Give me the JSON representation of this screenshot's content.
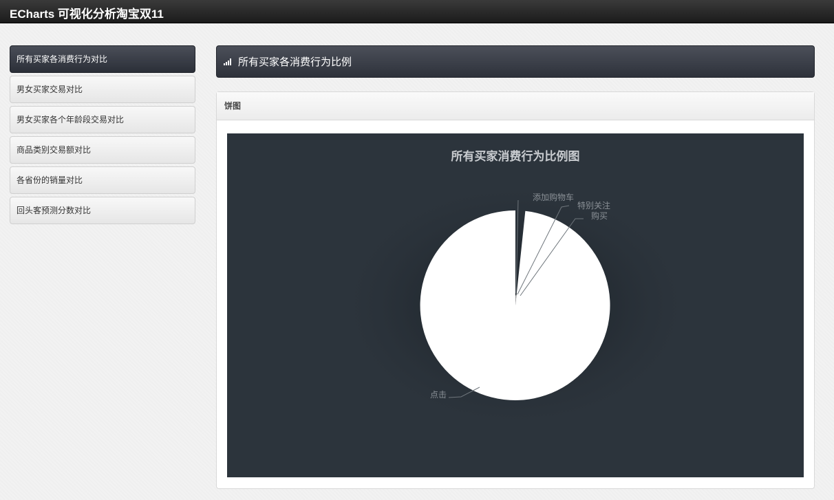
{
  "app": {
    "title": "ECharts 可视化分析淘宝双11"
  },
  "sidebar": {
    "items": [
      {
        "label": "所有买家各消费行为对比",
        "active": true
      },
      {
        "label": "男女买家交易对比"
      },
      {
        "label": "男女买家各个年龄段交易对比"
      },
      {
        "label": "商品类别交易额对比"
      },
      {
        "label": "各省份的销量对比"
      },
      {
        "label": "回头客预测分数对比"
      }
    ]
  },
  "main": {
    "header_icon": "signal-bars-icon",
    "title": "所有买家各消费行为比例",
    "panel_title": "饼图"
  },
  "colors": {
    "chart_bg": "#2c343c",
    "slice_main": "#ffffff",
    "label_text": "#8a9096"
  },
  "chart_data": {
    "type": "pie",
    "title": "所有买家消费行为比例图",
    "slices": [
      {
        "name": "点击",
        "value": 88.5
      },
      {
        "name": "添加购物车",
        "value": 0.2
      },
      {
        "name": "特别关注",
        "value": 0.6
      },
      {
        "name": "购买",
        "value": 0.7
      }
    ]
  }
}
